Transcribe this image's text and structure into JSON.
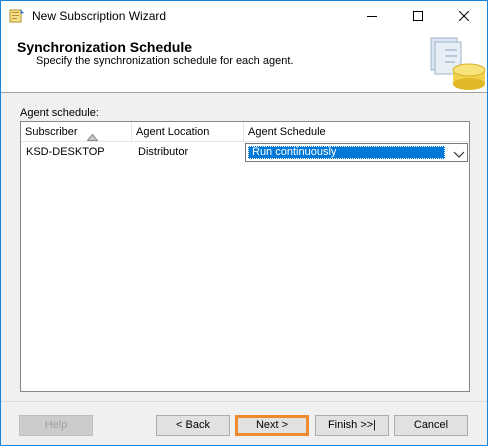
{
  "window": {
    "title": "New Subscription Wizard"
  },
  "icons": {
    "app": "wizard-app-icon",
    "minimize": "minimize-icon",
    "maximize": "maximize-icon",
    "close": "close-icon",
    "header_graphic": "database-subscription-graphic",
    "sort": "sort-ascending-icon",
    "dropdown": "chevron-down-icon"
  },
  "header": {
    "title": "Synchronization Schedule",
    "subtitle": "Specify the synchronization schedule for each agent."
  },
  "agent_schedule": {
    "label": "Agent schedule:",
    "columns": [
      "Subscriber",
      "Agent Location",
      "Agent Schedule"
    ],
    "rows": [
      {
        "subscriber": "KSD-DESKTOP",
        "agent_location": "Distributor",
        "agent_schedule": "Run continuously"
      }
    ]
  },
  "buttons": {
    "help": "Help",
    "back": "< Back",
    "next": "Next >",
    "finish": "Finish >>|",
    "cancel": "Cancel"
  },
  "colors": {
    "selection": "#0078d7",
    "highlight_border": "#f18a2c",
    "window_border": "#1883d7"
  }
}
